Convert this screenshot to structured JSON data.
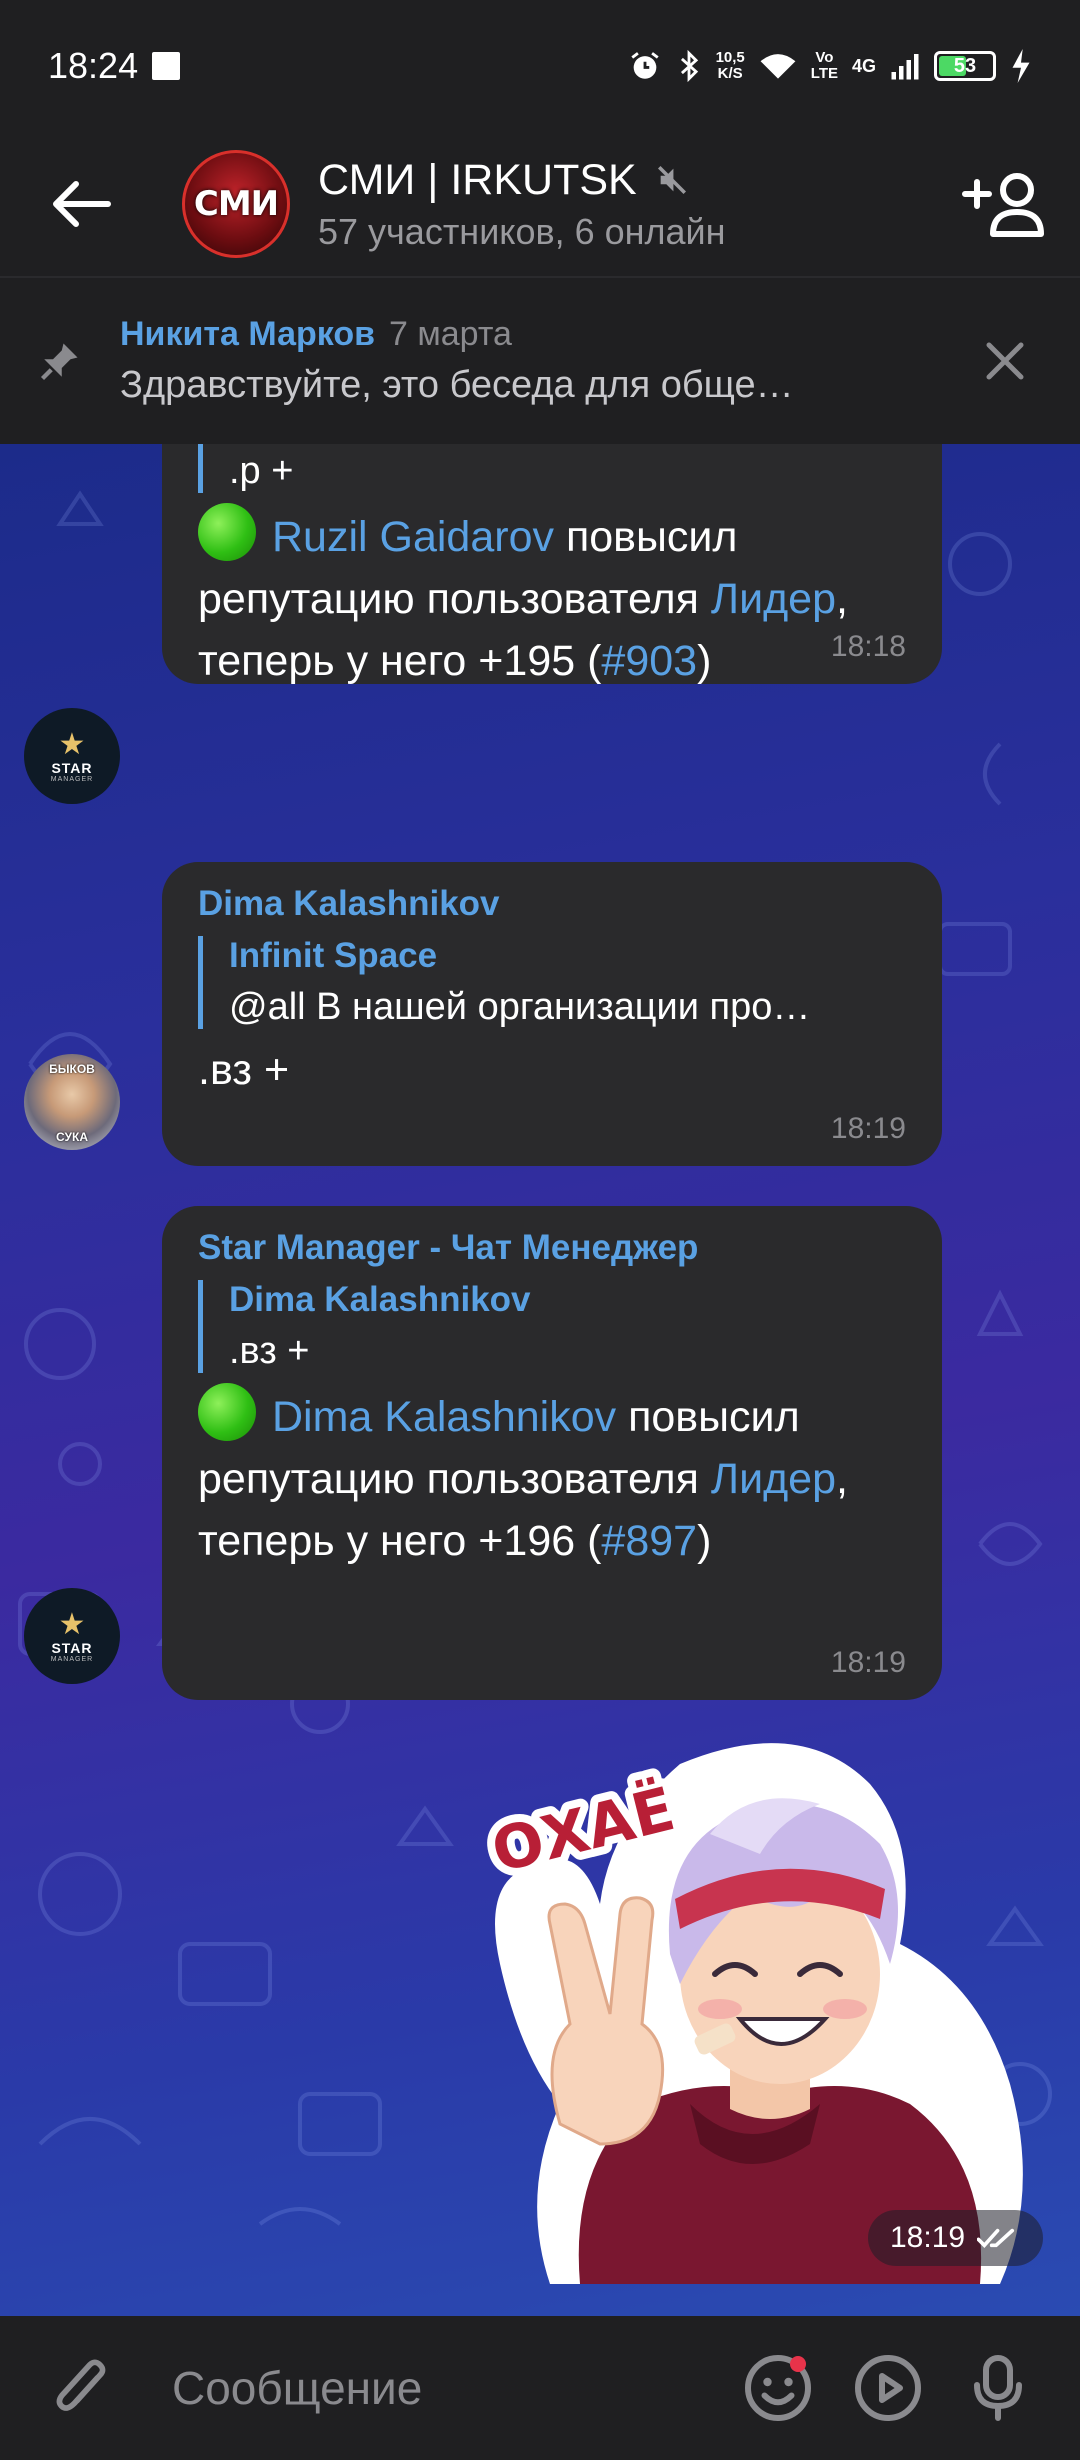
{
  "status_bar": {
    "time": "18:24",
    "net_speed_value": "10,5",
    "net_speed_unit": "K/S",
    "volte_top": "Vo",
    "volte_bottom": "LTE",
    "network": "4G",
    "battery": "53",
    "battery_level": 0.53
  },
  "header": {
    "title": "СМИ | IRKUTSK",
    "avatar_text": "СМИ",
    "subtitle": "57 участников, 6 онлайн"
  },
  "pinned": {
    "author": "Никита Марков",
    "date": "7 марта",
    "text": "Здравствуйте, это беседа для обще…"
  },
  "messages": [
    {
      "reply_text": ".р +",
      "action_user": "Ruzil Gaidarov",
      "action_text_1": " повысил репутацию пользователя ",
      "target_user": "Лидер",
      "action_text_2": ", теперь у него +195 (",
      "tag": "#903",
      "action_text_3": ")",
      "time": "18:18",
      "avatar_label": "STAR",
      "avatar_sub": "MANAGER"
    },
    {
      "sender": "Dima Kalashnikov",
      "reply_name": "Infinit Space",
      "reply_text": "@all В нашей организации про…",
      "text": ".вз +",
      "time": "18:19",
      "avatar_top": "БЫКОВ",
      "avatar_bottom": "СУКА"
    },
    {
      "sender": "Star Manager - Чат Менеджер",
      "reply_name": "Dima Kalashnikov",
      "reply_text": ".вз +",
      "action_user": "Dima Kalashnikov",
      "action_text_1": " повысил репутацию пользователя ",
      "target_user": "Лидер",
      "action_text_2": ", теперь у него +196 (",
      "tag": "#897",
      "action_text_3": ")",
      "time": "18:19",
      "avatar_label": "STAR",
      "avatar_sub": "MANAGER"
    }
  ],
  "sticker": {
    "caption": "ОХАЁ",
    "time": "18:19"
  },
  "input": {
    "placeholder": "Сообщение"
  },
  "colors": {
    "link": "#5aa1e3",
    "bubble": "#2a2a2c",
    "bar": "#1f1f21"
  }
}
